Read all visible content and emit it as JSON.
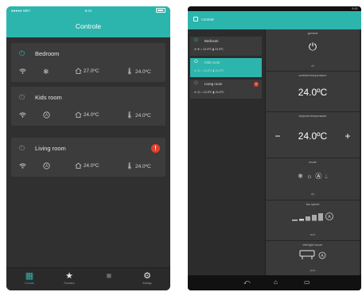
{
  "phone": {
    "status": {
      "carrier": "●●●●● WiFi",
      "time": "9:41"
    },
    "title": "Controle",
    "rooms": [
      {
        "name": "Bedroom",
        "room_temp": "27.0ºC",
        "set_temp": "24.0ºC",
        "power_on": true,
        "alert": ""
      },
      {
        "name": "Kids room",
        "room_temp": "24.0ºC",
        "set_temp": "24.0ºC",
        "power_on": false,
        "alert": ""
      },
      {
        "name": "Living room",
        "room_temp": "24.0ºC",
        "set_temp": "24.0ºC",
        "power_on": false,
        "alert": "!"
      }
    ],
    "tabs": [
      {
        "icon": "grid-icon",
        "label": "Controle",
        "active": true
      },
      {
        "icon": "star-icon",
        "label": "Favorites",
        "active": false
      },
      {
        "icon": "square-icon",
        "label": "",
        "active": false
      },
      {
        "icon": "gear-icon",
        "label": "Settings",
        "active": false
      }
    ]
  },
  "tablet": {
    "status": {
      "time": "9:41"
    },
    "app_title": "Controle",
    "rooms": [
      {
        "name": "Bedroom",
        "room_temp": "24.0ºC",
        "set_temp": "24.0ºC",
        "selected": false,
        "alert": ""
      },
      {
        "name": "Kids room",
        "room_temp": "24.0ºC",
        "set_temp": "24.0ºC",
        "selected": true,
        "alert": ""
      },
      {
        "name": "Living room",
        "room_temp": "24.0ºC",
        "set_temp": "24.0ºC",
        "selected": false,
        "alert": "!"
      }
    ],
    "panels": {
      "general": {
        "header": "general",
        "footer": "off"
      },
      "ambient": {
        "header": "ambient temperature",
        "value": "24.0ºC"
      },
      "setpoint": {
        "header": "setpoint temperature",
        "value": "24.0ºC",
        "minus": "−",
        "plus": "+"
      },
      "mode": {
        "header": "mode",
        "footer": "dry"
      },
      "fanspeed": {
        "header": "fan speed",
        "footer": "auto"
      },
      "louver": {
        "header": "left/right louver",
        "footer": "auto"
      }
    },
    "nav": {
      "back": "⤺",
      "home": "⌂",
      "recents": "▭"
    }
  },
  "colors": {
    "accent": "#2bb5ad",
    "alert": "#e0402f",
    "background": "#2f2f2f"
  }
}
